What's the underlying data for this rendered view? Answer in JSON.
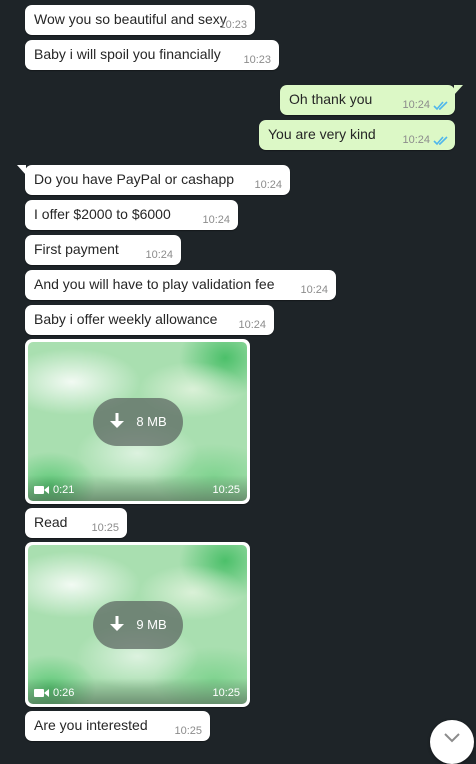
{
  "messages": [
    {
      "text": "Wow you so beautiful and sexy",
      "time": "10:23"
    },
    {
      "text": "Baby i will spoil you financially",
      "time": "10:23"
    },
    {
      "text": "Oh thank you",
      "time": "10:24"
    },
    {
      "text": "You are very kind",
      "time": "10:24"
    },
    {
      "text": "Do you have PayPal or cashapp",
      "time": "10:24"
    },
    {
      "text": "I offer $2000 to $6000",
      "time": "10:24"
    },
    {
      "text": "First payment",
      "time": "10:24"
    },
    {
      "text": "And you will have to play validation fee",
      "time": "10:24"
    },
    {
      "text": "Baby i offer weekly allowance",
      "time": "10:24"
    },
    {
      "text": "Read",
      "time": "10:25"
    },
    {
      "text": "Are you interested",
      "time": "10:25"
    }
  ],
  "videos": [
    {
      "size": "8 MB",
      "duration": "0:21",
      "time": "10:25"
    },
    {
      "size": "9 MB",
      "duration": "0:26",
      "time": "10:25"
    }
  ],
  "icons": {
    "read_receipt": "double-check-icon",
    "download": "download-arrow-icon",
    "video": "video-camera-icon",
    "scroll": "chevron-down-icon"
  },
  "colors": {
    "background": "#1e2428",
    "incoming_bubble": "#ffffff",
    "outgoing_bubble": "#dcf8c6",
    "read_tick": "#4fb6ec"
  }
}
